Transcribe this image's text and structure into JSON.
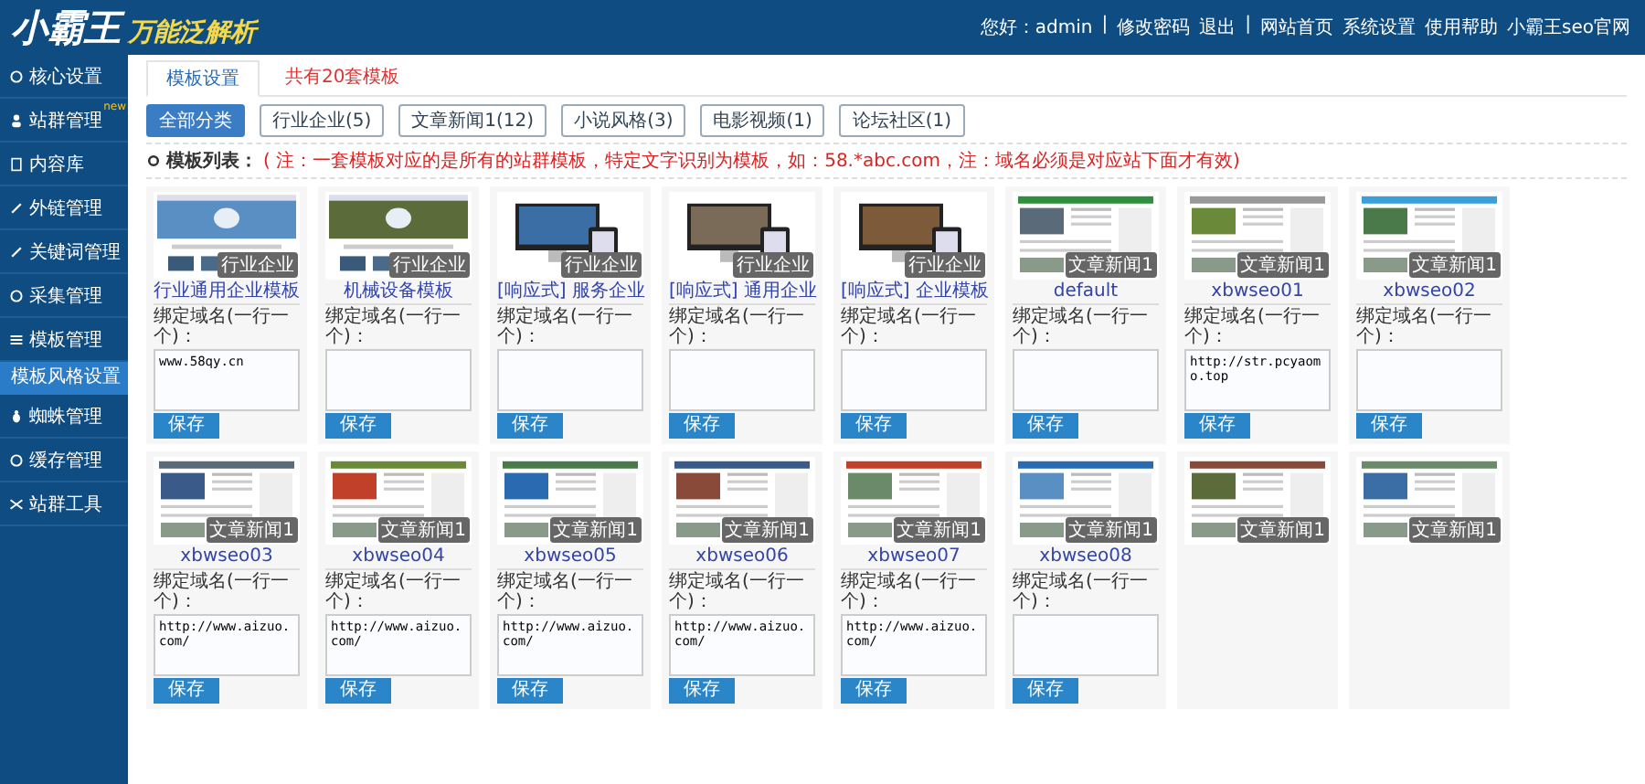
{
  "header": {
    "logo_main": "小霸王",
    "logo_sub": "万能泛解析",
    "links": [
      "您好：admin",
      "|",
      "修改密码",
      "退出",
      "|",
      "网站首页",
      "系统设置",
      "使用帮助",
      "小霸王seo官网"
    ]
  },
  "sidebar": {
    "items": [
      {
        "label": "核心设置",
        "selected": false
      },
      {
        "label": "站群管理",
        "selected": false,
        "badge": "new"
      },
      {
        "label": "内容库",
        "selected": false
      },
      {
        "label": "外链管理",
        "selected": false
      },
      {
        "label": "关键词管理",
        "selected": false
      },
      {
        "label": "采集管理",
        "selected": false
      },
      {
        "label": "模板管理",
        "selected": false,
        "children": [
          {
            "label": "模板风格设置",
            "selected": true
          }
        ]
      },
      {
        "label": "蜘蛛管理",
        "selected": false
      },
      {
        "label": "缓存管理",
        "selected": false
      },
      {
        "label": "站群工具",
        "selected": false
      }
    ]
  },
  "tabs": [
    {
      "label": "模板设置",
      "selected": true
    },
    {
      "label": "共有20套模板",
      "selected": false
    }
  ],
  "filters": [
    {
      "label": "全部分类",
      "selected": true
    },
    {
      "label": "行业企业(5)",
      "selected": false
    },
    {
      "label": "文章新闻1(12)",
      "selected": false
    },
    {
      "label": "小说风格(3)",
      "selected": false
    },
    {
      "label": "电影视频(1)",
      "selected": false
    },
    {
      "label": "论坛社区(1)",
      "selected": false
    }
  ],
  "list_heading": {
    "title": "模板列表：",
    "note": "( 注：一套模板对应的是所有的站群模板，特定文字识别为模板，如：58.*abc.com，注：域名必须是对应站下面才有效)"
  },
  "templates": [
    {
      "name": "行业通用企业模板",
      "category": "行业企业",
      "label": "绑定域名(一行一个)：",
      "domains": "www.58qy.cn",
      "button": "保存"
    },
    {
      "name": "机械设备模板",
      "category": "行业企业",
      "label": "绑定域名(一行一个)：",
      "button": "保存"
    },
    {
      "name": "[响应式] 服务企业",
      "category": "行业企业",
      "label": "绑定域名(一行一个)：",
      "button": "保存"
    },
    {
      "name": "[响应式] 通用企业",
      "category": "行业企业",
      "label": "绑定域名(一行一个)：",
      "button": "保存"
    },
    {
      "name": "[响应式] 企业模板",
      "category": "行业企业",
      "label": "绑定域名(一行一个)：",
      "button": "保存"
    },
    {
      "name": "default",
      "category": "文章新闻1",
      "label": "绑定域名(一行一个)：",
      "button": "保存"
    },
    {
      "name": "xbwseo01",
      "category": "文章新闻1",
      "label": "绑定域名(一行一个)：",
      "domains": "http://str.pcyaomo.top",
      "button": "保存"
    },
    {
      "name": "xbwseo02",
      "category": "文章新闻1",
      "label": "绑定域名(一行一个)：",
      "button": "保存"
    },
    {
      "name": "xbwseo03",
      "category": "文章新闻1",
      "label": "绑定域名(一行一个)：",
      "domains": "http://www.aizuo.com/",
      "button": "保存"
    },
    {
      "name": "xbwseo04",
      "category": "文章新闻1",
      "label": "绑定域名(一行一个)：",
      "domains": "http://www.aizuo.com/",
      "button": "保存"
    },
    {
      "name": "xbwseo05",
      "category": "文章新闻1",
      "label": "绑定域名(一行一个)：",
      "domains": "http://www.aizuo.com/",
      "button": "保存"
    },
    {
      "name": "xbwseo06",
      "category": "文章新闻1",
      "label": "绑定域名(一行一个)：",
      "domains": "http://www.aizuo.com/",
      "button": "保存"
    },
    {
      "name": "xbwseo07",
      "category": "文章新闻1",
      "label": "绑定域名(一行一个)：",
      "domains": "http://www.aizuo.com/",
      "button": "保存"
    },
    {
      "name": "xbwseo08",
      "category": "文章新闻1",
      "label": "绑定域名(一行一个)：",
      "button": "保存"
    },
    {
      "category": "文章新闻1"
    },
    {
      "category": "文章新闻1"
    }
  ]
}
